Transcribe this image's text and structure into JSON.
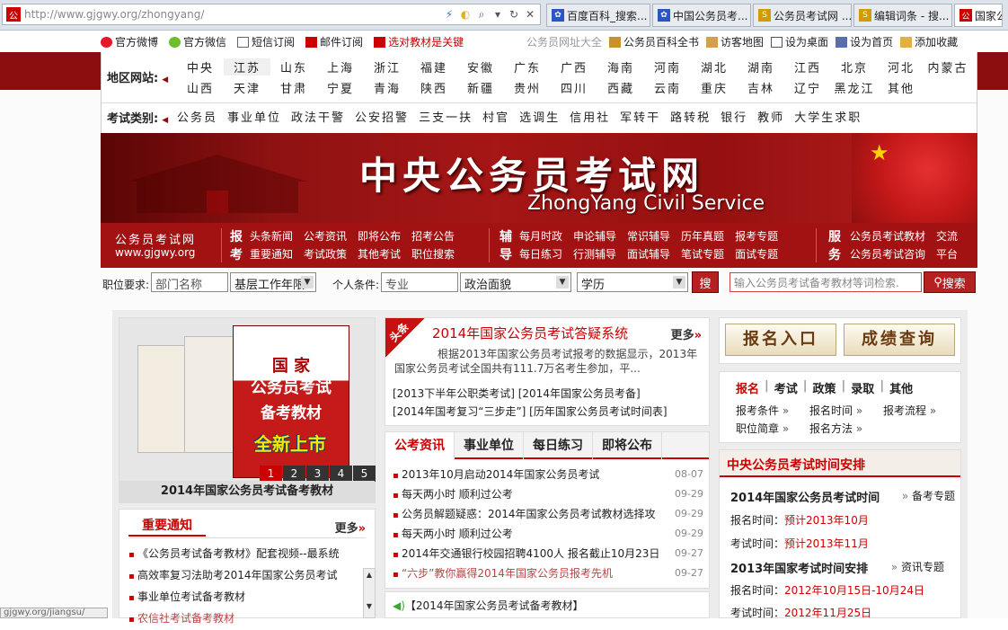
{
  "browser": {
    "url": "http://www.gjgwy.org/zhongyang/",
    "tabs": [
      "百度百科_搜索...",
      "中国公务员考...",
      "公务员考试网 ...",
      "编辑词条 - 搜...",
      "国家公"
    ],
    "status": "gjgwy.org/jiangsu/"
  },
  "topbar": {
    "left": [
      "官方微博",
      "官方微信",
      "短信订阅",
      "邮件订阅",
      "选对教材是关键"
    ],
    "right": [
      "公务员网址大全",
      "公务员百科全书",
      "访客地图",
      "设为桌面",
      "设为首页",
      "添加收藏"
    ]
  },
  "regions": {
    "label": "地区网站:",
    "row1": [
      "中央",
      "江苏",
      "山东",
      "上海",
      "浙江",
      "福建",
      "安徽",
      "广东",
      "广西",
      "海南",
      "河南",
      "湖北",
      "湖南",
      "江西",
      "北京",
      "河北",
      "内蒙古"
    ],
    "row2": [
      "山西",
      "天津",
      "甘肃",
      "宁夏",
      "青海",
      "陕西",
      "新疆",
      "贵州",
      "四川",
      "西藏",
      "云南",
      "重庆",
      "吉林",
      "辽宁",
      "黑龙江",
      "其他"
    ]
  },
  "categories": {
    "label": "考试类别:",
    "items": [
      "公务员",
      "事业单位",
      "政法干警",
      "公安招警",
      "三支一扶",
      "村官",
      "选调生",
      "信用社",
      "军转干",
      "路转税",
      "银行",
      "教师",
      "大学生求职"
    ]
  },
  "banner": {
    "title": "中央公务员考试网",
    "subtitle": "ZhongYang Civil Service"
  },
  "nav": {
    "brand1": "公务员考试网",
    "brand2": "www.gjgwy.org",
    "g1label": "报考",
    "g1r1": [
      "头条新闻",
      "公考资讯",
      "即将公布",
      "招考公告"
    ],
    "g1r2": [
      "重要通知",
      "考试政策",
      "其他考试",
      "职位搜索"
    ],
    "g2label": "辅导",
    "g2r1": [
      "每月时政",
      "申论辅导",
      "常识辅导",
      "历年真题",
      "报考专题"
    ],
    "g2r2": [
      "每日练习",
      "行测辅导",
      "面试辅导",
      "笔试专题",
      "面试专题"
    ],
    "g3label": "服务",
    "g3r1": [
      "公务员考试教材",
      "交流"
    ],
    "g3r2": [
      "公务员考试咨询",
      "平台"
    ]
  },
  "search": {
    "job_label": "职位要求:",
    "dept_ph": "部门名称",
    "level": "基层工作年限",
    "personal_label": "个人条件:",
    "major_ph": "专业",
    "politics": "政治面貌",
    "edu": "学历",
    "search_btn": "搜",
    "site_ph": "输入公务员考试备考教材等词检索.",
    "site_btn": "搜索"
  },
  "promo": {
    "book1": "国 家",
    "book2": "公务员考试",
    "book3": "备考教材",
    "badge": "全新上市",
    "caption": "2014年国家公务员考试备考教材",
    "pages": [
      "1",
      "2",
      "3",
      "4",
      "5"
    ]
  },
  "headline": {
    "ribbon": "头条",
    "title": "2014年国家公务员考试答疑系统",
    "more": "更多",
    "para": "根据2013年国家公务员考试报考的数据显示，2013年国家公务员考试全国共有111.7万名考生参加，平...",
    "tag1a": "[2013下半年公职类考试]",
    "tag1b": "[2014年国家公务员考备]",
    "tag2a": "[2014年国考复习“三步走”]",
    "tag2b": "[历年国家公务员考试时间表]"
  },
  "newstabs": {
    "tabs": [
      "公考资讯",
      "事业单位",
      "每日练习",
      "即将公布"
    ],
    "items": [
      {
        "t": "2013年10月启动2014年国家公务员考试",
        "d": "08-07"
      },
      {
        "t": "每天两小时 顺利过公考",
        "d": "09-29"
      },
      {
        "t": "公务员解题疑惑：2014年国家公务员考试教材选择攻",
        "d": "09-29"
      },
      {
        "t": "每天两小时 顺利过公考",
        "d": "09-29"
      },
      {
        "t": "2014年交通银行校园招聘4100人 报名截止10月23日",
        "d": "09-27"
      },
      {
        "t": "“六步”教你赢得2014年国家公务员报考先机",
        "d": "09-27"
      }
    ],
    "notice": "【2014年国家公务员考试备考教材】"
  },
  "important": {
    "title": "重要通知",
    "more": "更多",
    "items": [
      "《公务员考试备考教材》配套视频--最系统",
      "高效率复习法助考2014年国家公务员考试",
      "事业单位考试备考教材",
      "农信社考试备考教材"
    ]
  },
  "right": {
    "btn1": "报名入口",
    "btn2": "成绩查询",
    "links_head": [
      "报名",
      "考试",
      "政策",
      "录取",
      "其他"
    ],
    "row1": [
      "报考条件",
      "报名时间",
      "报考流程"
    ],
    "row2": [
      "职位简章",
      "报名方法"
    ]
  },
  "schedule": {
    "head": "中央公务员考试时间安排",
    "y1": "2014年国家公务员考试时间",
    "y1link": "备考专题",
    "y1reg_l": "报名时间：",
    "y1reg": "预计2013年10月",
    "y1exam_l": "考试时间：",
    "y1exam": "预计2013年11月",
    "y2": "2013年国家考试时间安排",
    "y2link": "资讯专题",
    "y2reg_l": "报名时间：",
    "y2reg": "2012年10月15日-10月24日",
    "y2exam_l": "考试时间：",
    "y2exam": "2012年11月25日"
  },
  "colors": {
    "brand_red": "#a31212",
    "dark_red": "#8b0d0d",
    "accent": "#cc0000"
  }
}
